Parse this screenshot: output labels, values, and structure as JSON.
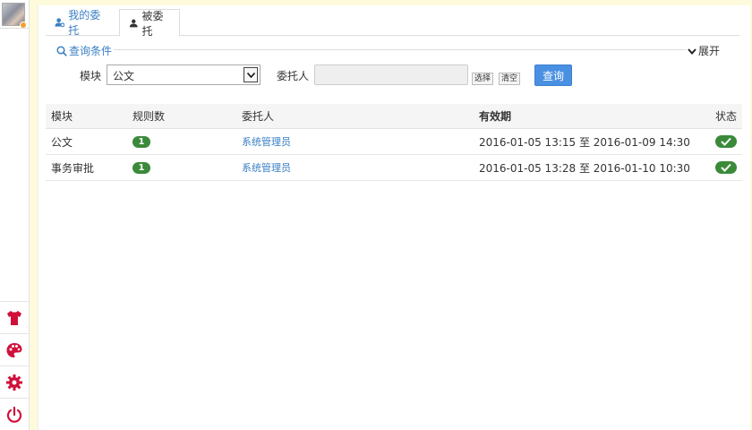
{
  "colors": {
    "accent": "#3a7fc4",
    "brand_red": "#d0103a",
    "success": "#3a8a3a",
    "query_button": "#4a90e2"
  },
  "sidebar": {
    "avatar_icon": "user-avatar",
    "buttons": [
      {
        "icon": "tshirt-icon"
      },
      {
        "icon": "palette-icon"
      },
      {
        "icon": "gear-icon"
      },
      {
        "icon": "power-icon"
      }
    ]
  },
  "tabs": [
    {
      "label": "我的委托",
      "icon": "user-gear-icon",
      "active": false
    },
    {
      "label": "被委托",
      "icon": "user-icon",
      "active": true
    }
  ],
  "query": {
    "legend": "查询条件",
    "expand_label": "展开",
    "module_label": "模块",
    "module_value": "公文",
    "delegator_label": "委托人",
    "delegator_value": "",
    "select_button": "选择",
    "clear_button": "清空",
    "submit_button": "查询"
  },
  "table": {
    "headers": [
      "模块",
      "规则数",
      "委托人",
      "有效期",
      "状态"
    ],
    "rows": [
      {
        "module": "公文",
        "rules": "1",
        "delegator": "系统管理员",
        "validity": "2016-01-05 13:15 至 2016-01-09 14:30",
        "status": "enabled"
      },
      {
        "module": "事务审批",
        "rules": "1",
        "delegator": "系统管理员",
        "validity": "2016-01-05 13:28 至 2016-01-10 10:30",
        "status": "enabled"
      }
    ]
  }
}
